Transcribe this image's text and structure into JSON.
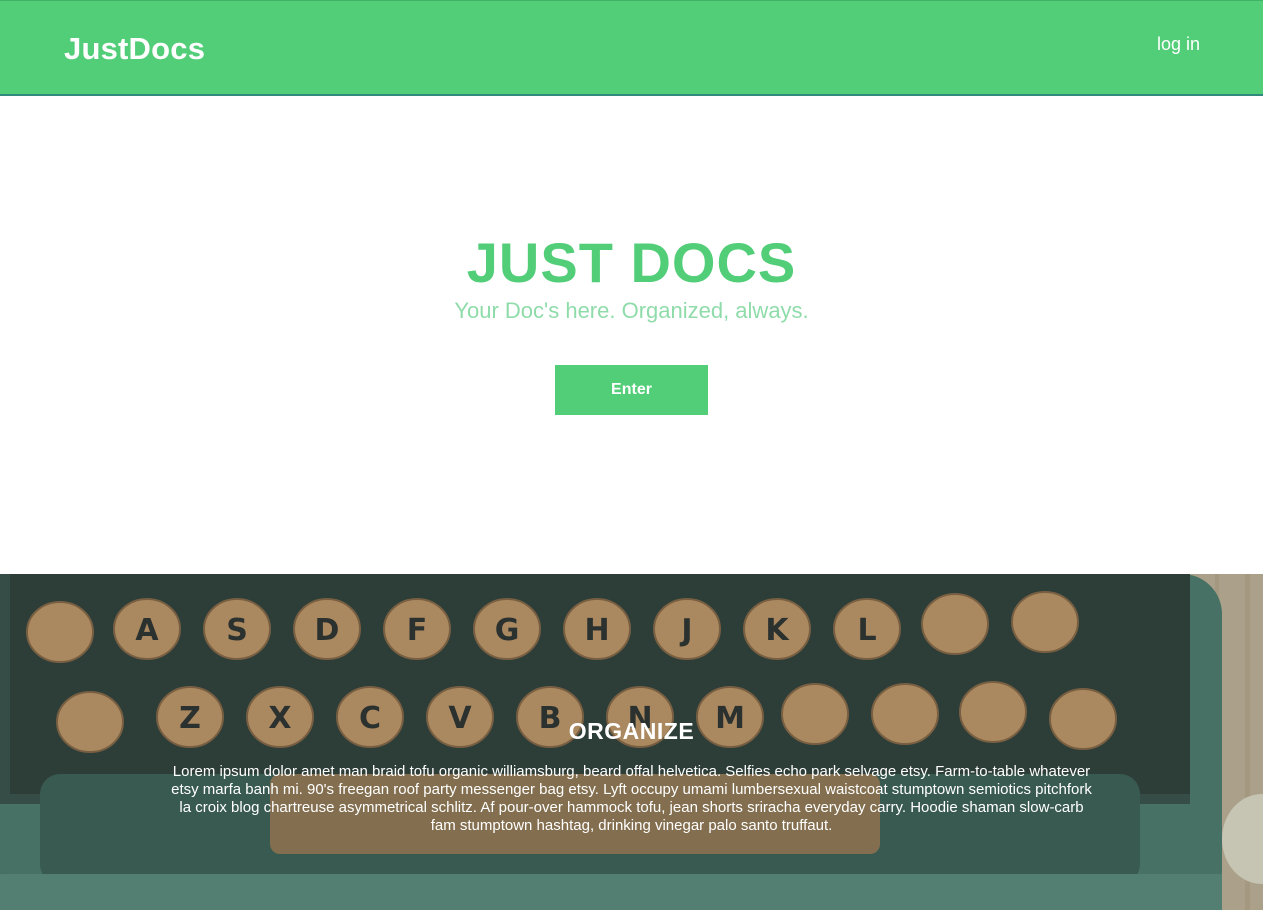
{
  "navbar": {
    "brand": "JustDocs",
    "login_label": "log in"
  },
  "hero": {
    "title": "JUST DOCS",
    "subtitle": "Your Doc's here. Organized, always.",
    "enter_label": "Enter"
  },
  "feature": {
    "title": "ORGANIZE",
    "text": "Lorem ipsum dolor amet man braid tofu organic williamsburg, beard offal helvetica. Selfies echo park selvage etsy. Farm-to-table whatever etsy marfa banh mi. 90's freegan roof party messenger bag etsy. Lyft occupy umami lumbersexual waistcoat stumptown semiotics pitchfork la croix blog chartreuse asymmetrical schlitz. Af pour-over hammock tofu, jean shorts sriracha everyday carry. Hoodie shaman slow-carb fam stumptown hashtag, drinking vinegar palo santo truffaut.",
    "image": "typewriter-keyboard-photo",
    "keys_row1": [
      "A",
      "S",
      "D",
      "F",
      "G",
      "H",
      "J",
      "K",
      "L"
    ],
    "keys_row2": [
      "Z",
      "X",
      "C",
      "V",
      "B",
      "N",
      "M"
    ]
  },
  "colors": {
    "accent": "#52cd78",
    "subtitle": "#8fdcaa",
    "white": "#ffffff"
  }
}
